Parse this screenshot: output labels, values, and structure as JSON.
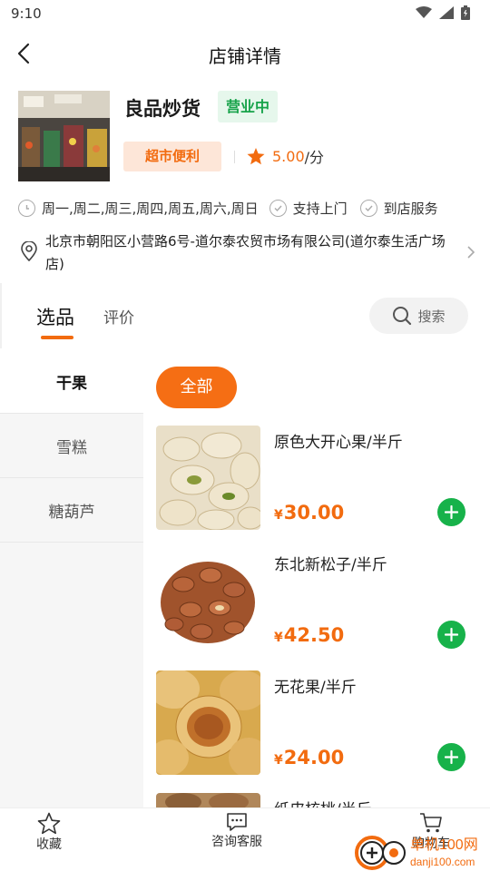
{
  "status_bar": {
    "time": "9:10"
  },
  "nav": {
    "title": "店铺详情"
  },
  "shop": {
    "name": "良品炒货",
    "status_badge": "营业中",
    "category": "超市便利",
    "rating_value": "5.00",
    "rating_unit": "/分",
    "hours": "周一,周二,周三,周四,周五,周六,周日",
    "service_1": "支持上门",
    "service_2": "到店服务",
    "address": "北京市朝阳区小营路6号-道尔泰农贸市场有限公司(道尔泰生活广场店)"
  },
  "tabs": {
    "active": "选品",
    "other": "评价",
    "search_label": "搜索"
  },
  "sidebar": {
    "items": [
      {
        "label": "干果"
      },
      {
        "label": "雪糕"
      },
      {
        "label": "糖葫芦"
      }
    ]
  },
  "filter": {
    "all_label": "全部"
  },
  "products": [
    {
      "name": "原色大开心果/半斤",
      "price": "30.00",
      "currency": "¥"
    },
    {
      "name": "东北新松子/半斤",
      "price": "42.50",
      "currency": "¥"
    },
    {
      "name": "无花果/半斤",
      "price": "24.00",
      "currency": "¥"
    },
    {
      "name": "纸皮核桃/半斤",
      "price": "",
      "currency": "¥"
    }
  ],
  "bottom_bar": {
    "favorite": "收藏",
    "consult": "咨询客服",
    "cart": "购物车"
  },
  "watermark": {
    "text": "单机100网",
    "url": "danji100.com"
  },
  "colors": {
    "accent": "#f26b0f",
    "green": "#17b24a",
    "open_bg": "#e6f7ec"
  }
}
